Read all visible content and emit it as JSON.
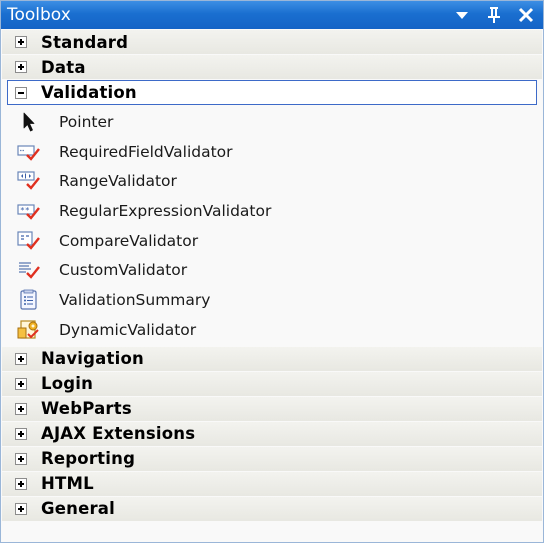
{
  "window": {
    "title": "Toolbox"
  },
  "groups_before": [
    {
      "label": "Standard"
    },
    {
      "label": "Data"
    }
  ],
  "expanded_group": {
    "label": "Validation",
    "items": [
      {
        "label": "Pointer",
        "icon": "pointer-icon"
      },
      {
        "label": "RequiredFieldValidator",
        "icon": "required-field-validator-icon"
      },
      {
        "label": "RangeValidator",
        "icon": "range-validator-icon"
      },
      {
        "label": "RegularExpressionValidator",
        "icon": "regular-expression-validator-icon"
      },
      {
        "label": "CompareValidator",
        "icon": "compare-validator-icon"
      },
      {
        "label": "CustomValidator",
        "icon": "custom-validator-icon"
      },
      {
        "label": "ValidationSummary",
        "icon": "validation-summary-icon"
      },
      {
        "label": "DynamicValidator",
        "icon": "dynamic-validator-icon"
      }
    ]
  },
  "groups_after": [
    {
      "label": "Navigation"
    },
    {
      "label": "Login"
    },
    {
      "label": "WebParts"
    },
    {
      "label": "AJAX Extensions"
    },
    {
      "label": "Reporting"
    },
    {
      "label": "HTML"
    },
    {
      "label": "General"
    }
  ],
  "colors": {
    "titlebar": "#1a6fd0",
    "selection_border": "#3d6ac8",
    "check_red": "#e03020"
  }
}
